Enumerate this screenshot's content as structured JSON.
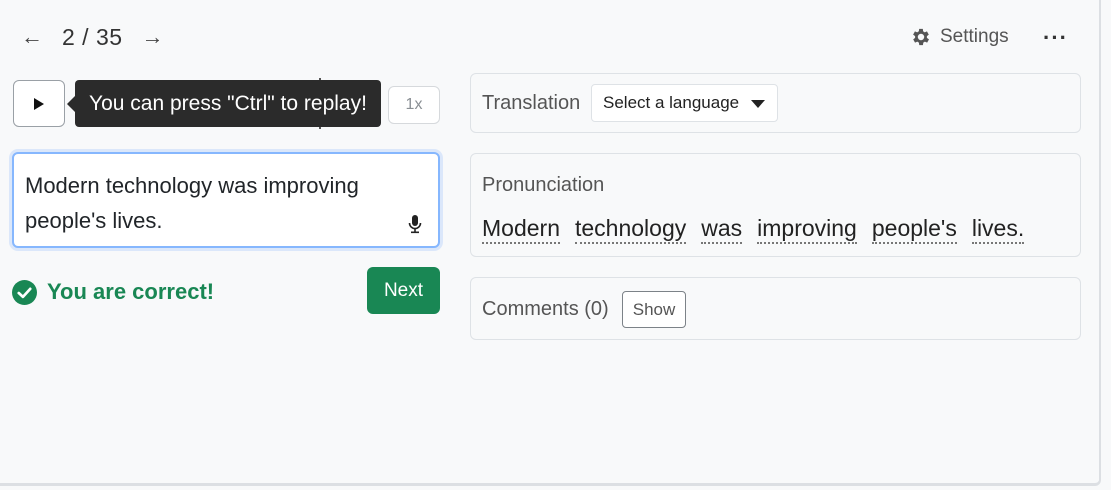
{
  "nav": {
    "prev_icon": "←",
    "counter": "2 / 35",
    "next_icon": "→"
  },
  "header": {
    "settings_label": "Settings",
    "more_label": "···"
  },
  "player": {
    "tooltip": "You can press \"Ctrl\" to replay!",
    "speed": "1x"
  },
  "answer": {
    "text": "Modern technology was improving people's lives."
  },
  "result": {
    "message": "You are correct!",
    "next_label": "Next"
  },
  "translation": {
    "label": "Translation",
    "select_value": "Select a language"
  },
  "pronunciation": {
    "label": "Pronunciation",
    "words": [
      "Modern",
      "technology",
      "was",
      "improving",
      "people's",
      "lives."
    ]
  },
  "comments": {
    "label": "Comments (0)",
    "show_label": "Show"
  },
  "colors": {
    "success": "#198754",
    "focus_border": "#86b7fe",
    "tooltip_bg": "#2b2b2b"
  }
}
